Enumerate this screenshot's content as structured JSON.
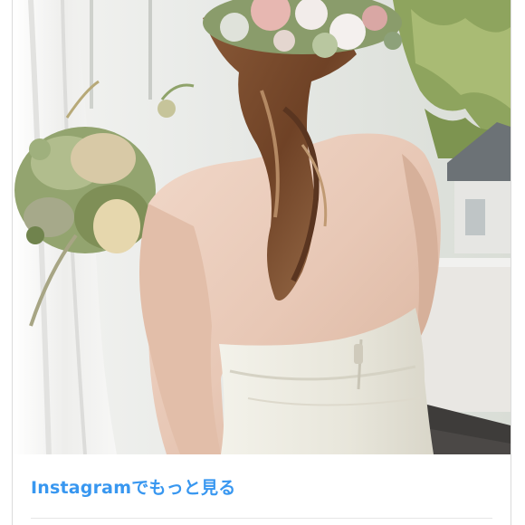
{
  "embed": {
    "more_link_label": "Instagramでもっと見る"
  },
  "photo": {
    "subject": "bride-back-with-flower-crown-and-bouquet",
    "palette": {
      "window_light": "#eef0ef",
      "curtain": "#f3f3f2",
      "greenery": "#7a8f56",
      "hair": "#7a4a2c",
      "skin": "#e9cdbd",
      "dress": "#ecebe2",
      "floor": "#3d3b39"
    }
  },
  "colors": {
    "link": "#3897f0",
    "border": "#dbdbdb",
    "divider": "#e6e6e6"
  }
}
